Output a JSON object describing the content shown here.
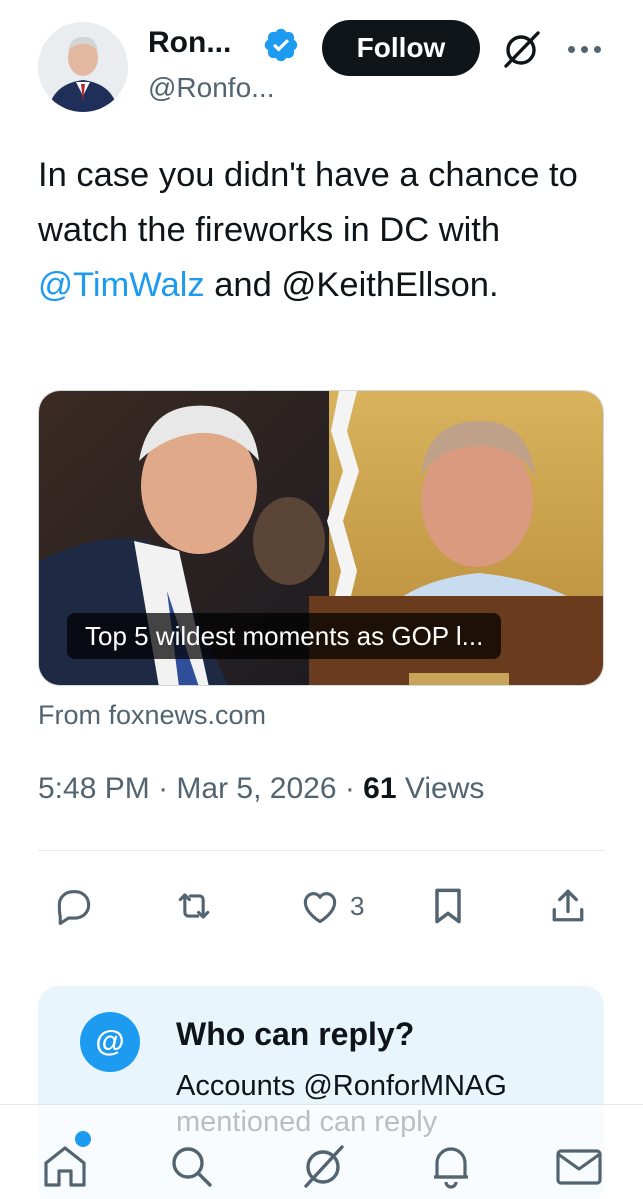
{
  "author": {
    "name": "Ron...",
    "handle": "@Ronfo...",
    "verified": true,
    "avatar": "avatar"
  },
  "header": {
    "follow_label": "Follow",
    "grok_icon": "grok-icon",
    "more_icon": "more-icon"
  },
  "tweet": {
    "text_1": "In case you didn't have a chance to watch the fireworks in DC with ",
    "mention_1": "@TimWalz",
    "text_2": " and ",
    "mention_2": "@KeithEllson",
    "text_3": "."
  },
  "card": {
    "caption": "Top 5 wildest moments as GOP l...",
    "source": "From foxnews.com"
  },
  "meta": {
    "time": "5:48 PM",
    "separator": " · ",
    "date": "Mar 5, 2026",
    "views_count": "61",
    "views_label": " Views"
  },
  "actions": {
    "reply_icon": "reply-icon",
    "repost_icon": "repost-icon",
    "like_icon": "like-icon",
    "like_count": "3",
    "bookmark_icon": "bookmark-icon",
    "share_icon": "share-icon"
  },
  "reply_settings": {
    "at_symbol": "@",
    "title": "Who can reply?",
    "description": "Accounts @RonforMNAG mentioned can reply"
  },
  "bottom_nav": {
    "items": [
      "home-icon",
      "search-icon",
      "grok-icon",
      "notifications-icon",
      "messages-icon"
    ],
    "home_has_dot": true
  },
  "colors": {
    "accent": "#1d9bf0",
    "text": "#0f1419",
    "secondary": "#536471",
    "reply_box_bg": "#e8f5fd"
  }
}
